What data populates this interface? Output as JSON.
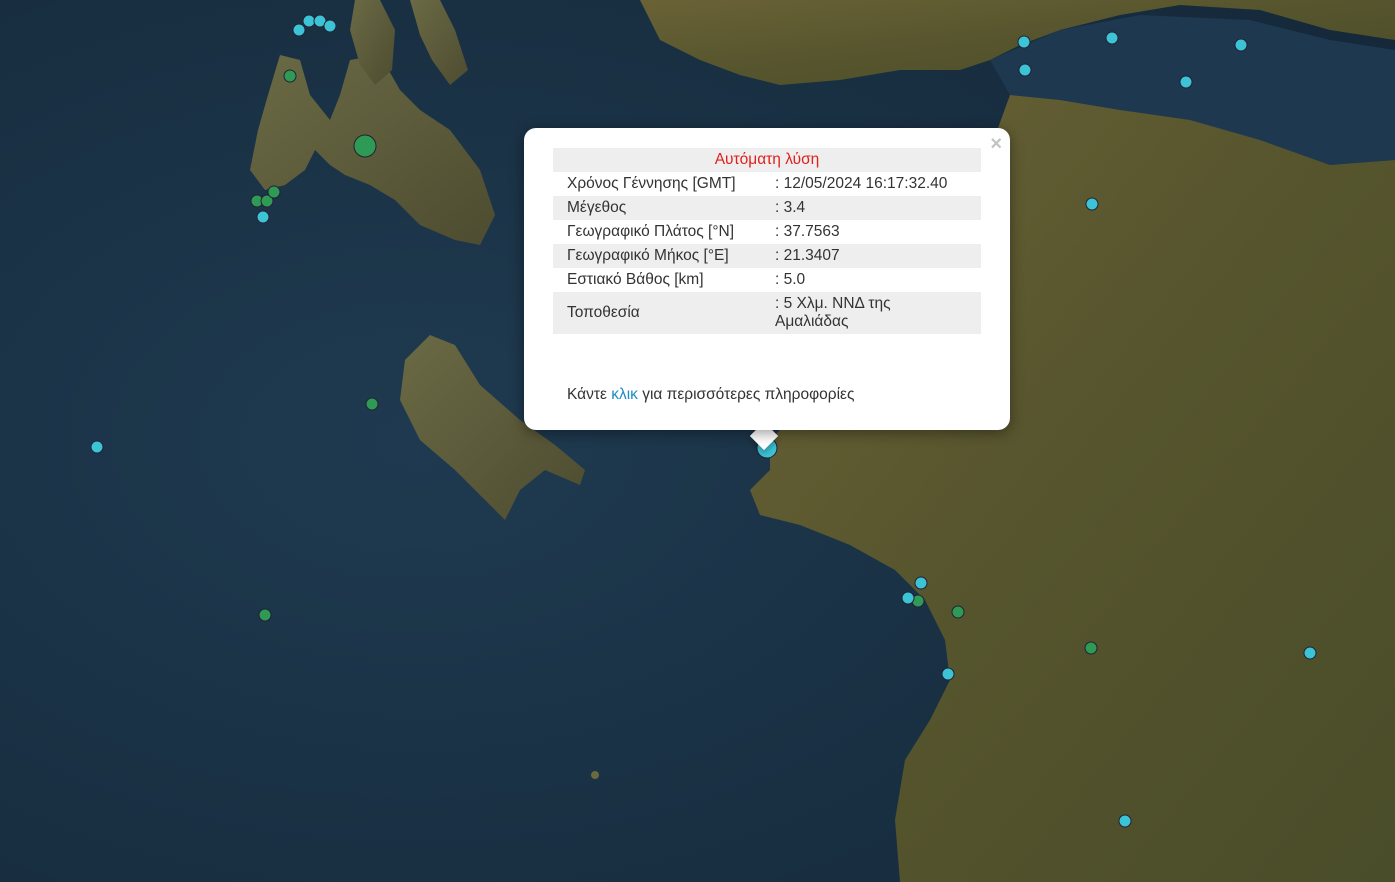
{
  "popup": {
    "title": "Αυτόματη λύση",
    "close_symbol": "×",
    "rows": [
      {
        "label": "Χρόνος Γέννησης [GMT]",
        "value": ": 12/05/2024 16:17:32.40"
      },
      {
        "label": "Μέγεθος",
        "value": ": 3.4"
      },
      {
        "label": "Γεωγραφικό Πλάτος [°N]",
        "value": ": 37.7563"
      },
      {
        "label": "Γεωγραφικό Μήκος [°E]",
        "value": ": 21.3407"
      },
      {
        "label": "Εστιακό Βάθος [km]",
        "value": ": 5.0"
      },
      {
        "label": "Τοποθεσία",
        "value": ": 5 Χλμ. ΝΝΔ της Αμαλιάδας"
      }
    ],
    "footer_before": "Κάντε ",
    "footer_link": "κλικ",
    "footer_after": " για περισσότερες πληροφορίες"
  },
  "colors": {
    "sea": "#1c3447",
    "land": "#5f5a30",
    "marker_blue": "#3cc3d6",
    "marker_green": "#2f9a56",
    "title_red": "#e0201c",
    "link_blue": "#1e8bc3"
  }
}
